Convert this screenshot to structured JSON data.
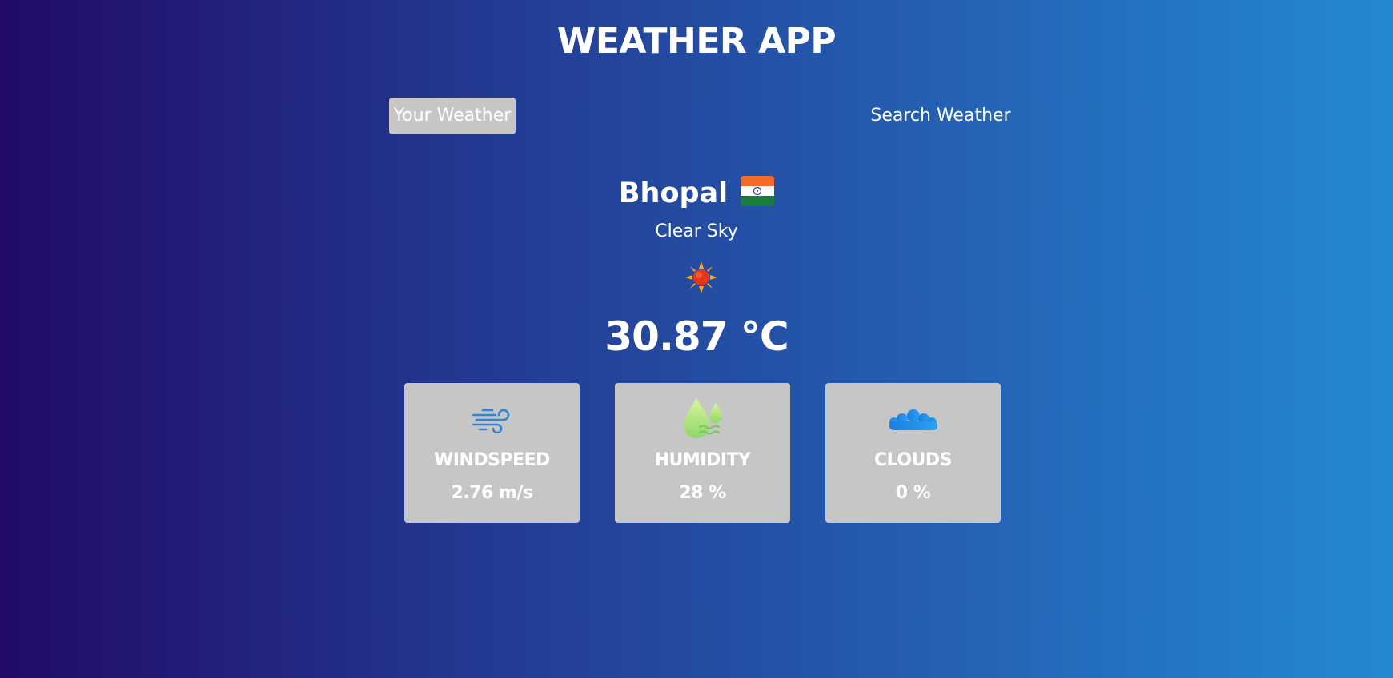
{
  "header": {
    "title": "WEATHER APP"
  },
  "tabs": [
    {
      "label": "Your Weather",
      "active": true
    },
    {
      "label": "Search Weather",
      "active": false
    }
  ],
  "weather": {
    "city": "Bhopal",
    "country_flag_icon": "india-flag-icon",
    "description": "Clear Sky",
    "condition_icon": "sun-icon",
    "temperature": "30.87 °C"
  },
  "metrics": [
    {
      "label": "WINDSPEED",
      "value": "2.76 m/s",
      "icon": "wind-icon"
    },
    {
      "label": "HUMIDITY",
      "value": "28 %",
      "icon": "humidity-icon"
    },
    {
      "label": "CLOUDS",
      "value": "0 %",
      "icon": "cloud-icon"
    }
  ],
  "colors": {
    "gradient_start": "#210b66",
    "gradient_end": "#2389d2",
    "card_bg": "#c6c6c6",
    "active_tab_bg": "#c6c6c6",
    "text": "#ffffff"
  }
}
